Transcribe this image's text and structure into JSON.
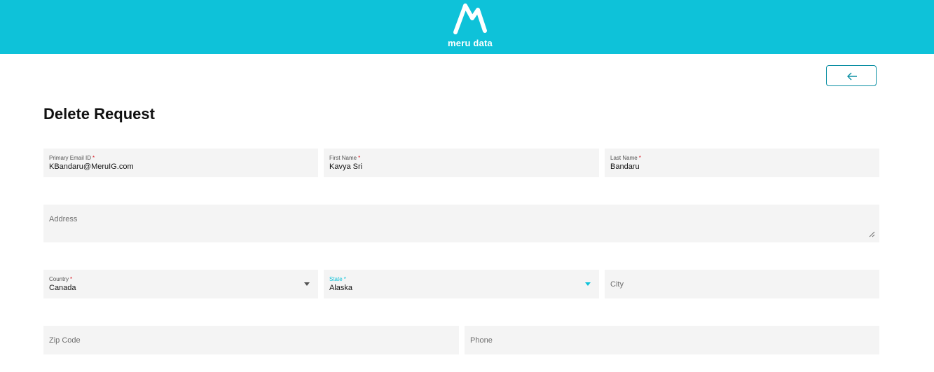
{
  "brand": {
    "name": "meru data",
    "header_color": "#0ec2d9"
  },
  "nav": {
    "back_icon": "arrow-left-icon"
  },
  "page": {
    "title": "Delete Request"
  },
  "form": {
    "email": {
      "label": "Primary Email ID",
      "required_mark": "*",
      "value": "KBandaru@MeruIG.com"
    },
    "first_name": {
      "label": "First Name",
      "required_mark": "*",
      "value": "Kavya Sri"
    },
    "last_name": {
      "label": "Last Name",
      "required_mark": "*",
      "value": "Bandaru"
    },
    "address": {
      "placeholder": "Address"
    },
    "country": {
      "label": "Country",
      "required_mark": "*",
      "value": "Canada"
    },
    "state": {
      "label": "State",
      "required_mark": "*",
      "value": "Alaska"
    },
    "city": {
      "placeholder": "City"
    },
    "zip": {
      "placeholder": "Zip Code"
    },
    "phone": {
      "placeholder": "Phone"
    }
  },
  "colors": {
    "accent": "#0ec2d9",
    "required": "#da1e28",
    "field_bg": "#f4f4f4"
  }
}
